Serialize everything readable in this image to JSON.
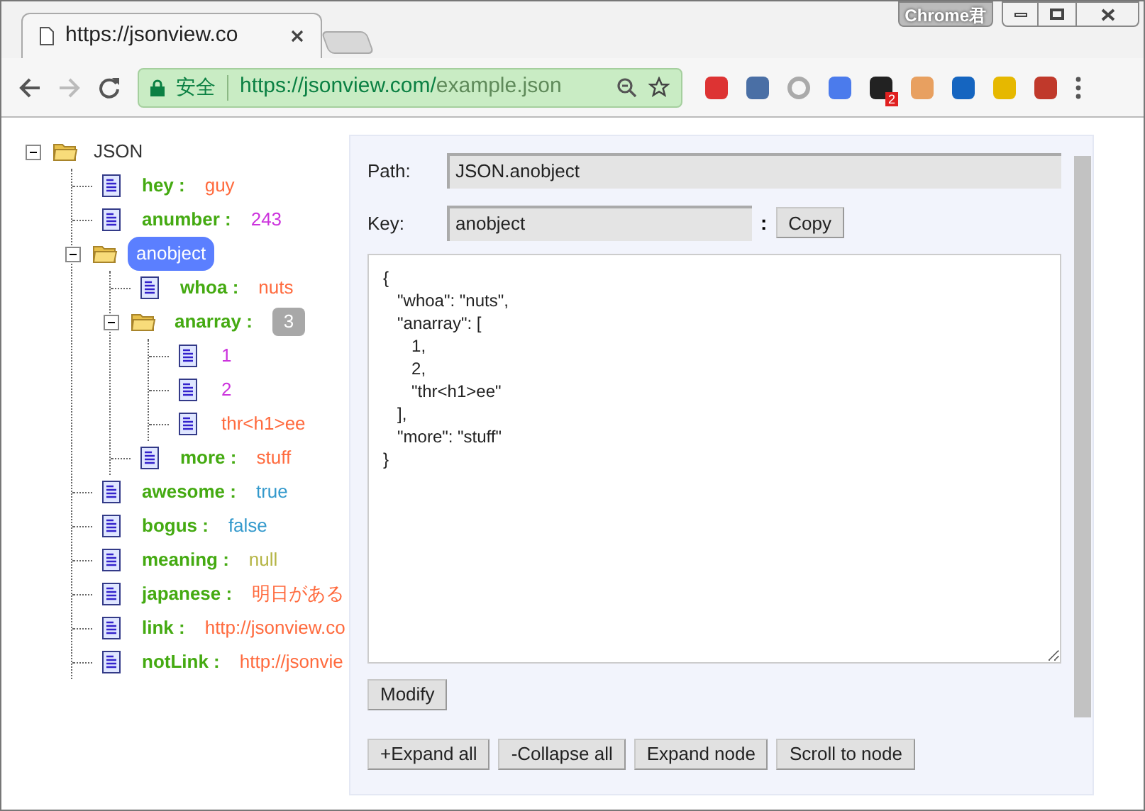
{
  "browser": {
    "tab_title": "https://jsonview.co",
    "profile": "Chrome君",
    "secure_label": "安全",
    "url_origin": "https://jsonview.com/",
    "url_path": "example.json",
    "extension_badge": "2"
  },
  "tree": {
    "label": "JSON",
    "expanded": true,
    "selected": false,
    "children": [
      {
        "key": "hey :",
        "value": "guy",
        "color": "#ff6a3d",
        "selected": false
      },
      {
        "key": "anumber :",
        "value": "243",
        "color": "#cc33dd",
        "selected": false
      },
      {
        "key": "anobject",
        "expanded": true,
        "selected": true,
        "children": [
          {
            "key": "whoa :",
            "value": "nuts",
            "color": "#ff6a3d",
            "selected": false
          },
          {
            "key": "anarray :",
            "count": "3",
            "expanded": true,
            "selected": false,
            "children": [
              {
                "value": "1",
                "color": "#cc33dd",
                "selected": false
              },
              {
                "value": "2",
                "color": "#cc33dd",
                "selected": false
              },
              {
                "value": "thr<h1>ee",
                "color": "#ff6a3d",
                "selected": false
              }
            ]
          },
          {
            "key": "more :",
            "value": "stuff",
            "color": "#ff6a3d",
            "selected": false
          }
        ]
      },
      {
        "key": "awesome :",
        "value": "true",
        "color": "#3399cc",
        "selected": false
      },
      {
        "key": "bogus :",
        "value": "false",
        "color": "#3399cc",
        "selected": false
      },
      {
        "key": "meaning :",
        "value": "null",
        "color": "#b5b545",
        "selected": false
      },
      {
        "key": "japanese :",
        "value": "明日がある",
        "color": "#ff6a3d",
        "selected": false
      },
      {
        "key": "link :",
        "value": "http://jsonview.co",
        "color": "#ff6a3d",
        "selected": false
      },
      {
        "key": "notLink :",
        "value": "http://jsonvie",
        "color": "#ff6a3d",
        "selected": false
      }
    ]
  },
  "panel": {
    "path_label": "Path:",
    "path_value": "JSON.anobject",
    "key_label": "Key:",
    "key_value": "anobject",
    "separator": ":",
    "copy_button": "Copy",
    "editor_text": "{\n   \"whoa\": \"nuts\",\n   \"anarray\": [\n      1,\n      2,\n      \"thr<h1>ee\"\n   ],\n   \"more\": \"stuff\"\n}",
    "modify_button": "Modify",
    "buttons": [
      "+Expand all",
      "-Collapse all",
      "Expand node",
      "Scroll to node"
    ]
  }
}
